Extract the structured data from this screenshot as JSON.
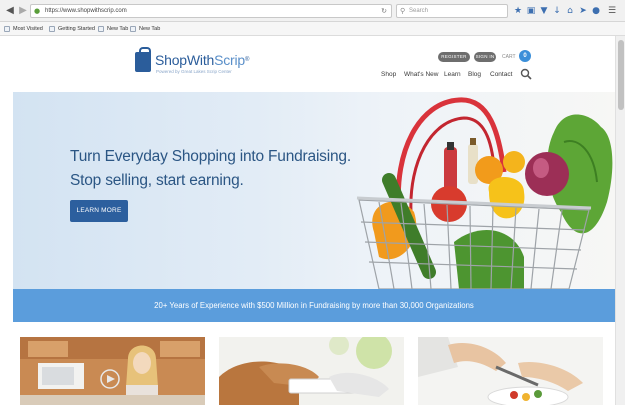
{
  "browser": {
    "url": "https://www.shopwithscrip.com",
    "search_placeholder": "Search",
    "toolbar_icons": [
      "star-icon",
      "reading-list-icon",
      "pocket-icon",
      "download-icon",
      "home-icon",
      "send-icon",
      "firefox-account-icon",
      "menu-icon"
    ],
    "bookmarks": [
      "Most Visited",
      "Getting Started",
      "New Tab",
      "New Tab"
    ]
  },
  "site": {
    "logo_main": "ShopWith",
    "logo_accent": "Scrip",
    "logo_mark": "®",
    "logo_tagline": "Powered by Great Lakes Scrip Center",
    "register_label": "REGISTER",
    "signin_label": "SIGN IN",
    "cart_label": "CART",
    "cart_count": "0",
    "nav": [
      "Shop",
      "What's New",
      "Learn",
      "Blog",
      "Contact"
    ]
  },
  "hero": {
    "headline_1": "Turn Everyday Shopping into Fundraising.",
    "headline_2": "Stop selling, start earning.",
    "cta_label": "LEARN MORE"
  },
  "banner": {
    "text": "20+ Years of Experience with $500 Million in Fundraising by more than 30,000 Organizations"
  },
  "colors": {
    "brand_blue": "#2b5d9b",
    "banner_blue": "#5b9ddc",
    "cta_blue": "#2c5f9e",
    "cart_badge": "#3b8fd9",
    "pill_gray": "#6e6e6e"
  }
}
